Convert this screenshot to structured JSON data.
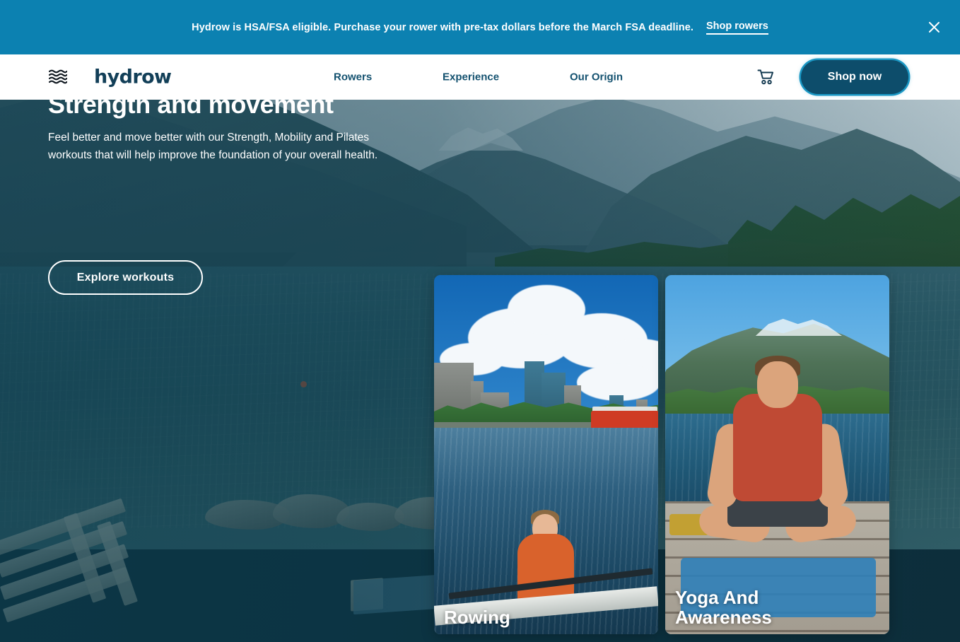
{
  "announcement": {
    "message": "Hydrow is HSA/FSA eligible. Purchase your rower with pre-tax dollars before the March FSA deadline.",
    "link_label": "Shop rowers",
    "close_icon": "close-icon",
    "background_color": "#0c81b1",
    "text_color": "#ffffff"
  },
  "nav": {
    "menu_icon": "wave-menu-icon",
    "brand": "hydrow",
    "links": [
      {
        "label": "Rowers"
      },
      {
        "label": "Experience"
      },
      {
        "label": "Our Origin"
      }
    ],
    "cart_icon": "shopping-cart-icon",
    "shop_now_label": "Shop now",
    "link_color": "#13516f",
    "button_color": "#0d4d6b",
    "button_glow_color": "#1a97c4"
  },
  "hero": {
    "title": "Strength and movement",
    "subtitle": "Feel better and move better with our Strength, Mobility and Pilates workouts that will help improve the foundation of your overall health.",
    "cta_label": "Explore workouts",
    "scene_description": "Fjord with mountains, lake water, grassy shoreline with rocks and wooden pallets",
    "overlay_color": "#0b3c4e"
  },
  "cards": [
    {
      "label": "Rowing",
      "scene_description": "Athlete rowing a single scull on the Charles River with Boston skyline and red duck boat"
    },
    {
      "label": "Yoga And\nAwareness",
      "scene_description": "Man seated cross-legged meditating on a wooden dock beside a fjord with snow-capped mountains"
    }
  ]
}
